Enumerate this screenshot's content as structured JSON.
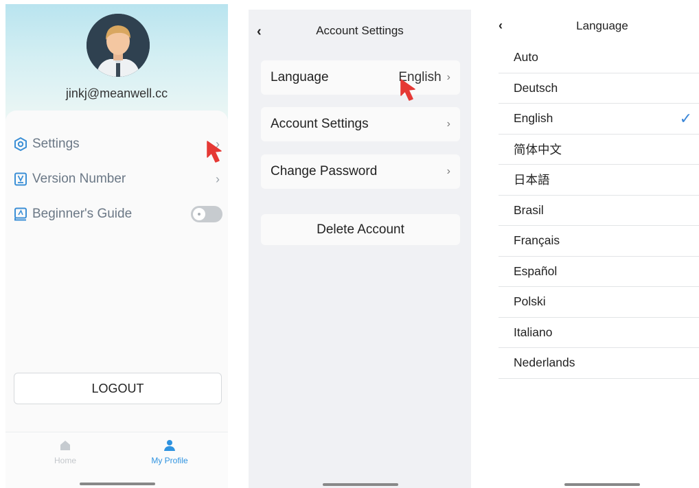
{
  "profile": {
    "email": "jinkj@meanwell.cc",
    "menu": {
      "settings": "Settings",
      "version": "Version Number",
      "guide": "Beginner's Guide"
    },
    "guide_toggle_on": false,
    "logout": "LOGOUT",
    "tabs": {
      "home": "Home",
      "my_profile": "My Profile"
    },
    "colors": {
      "accent": "#2f93e0",
      "hero": "#b9e4ef",
      "icon": "#3b8fd6"
    }
  },
  "account_settings": {
    "title": "Account Settings",
    "items": {
      "language": "Language",
      "language_value": "English",
      "account_settings": "Account Settings",
      "change_password": "Change Password",
      "delete_account": "Delete Account"
    }
  },
  "language": {
    "title": "Language",
    "options": [
      "Auto",
      "Deutsch",
      "English",
      "简体中文",
      "日本語",
      "Brasil",
      "Français",
      "Español",
      "Polski",
      "Italiano",
      "Nederlands"
    ],
    "selected": "English",
    "colors": {
      "check": "#3a86d8"
    }
  }
}
